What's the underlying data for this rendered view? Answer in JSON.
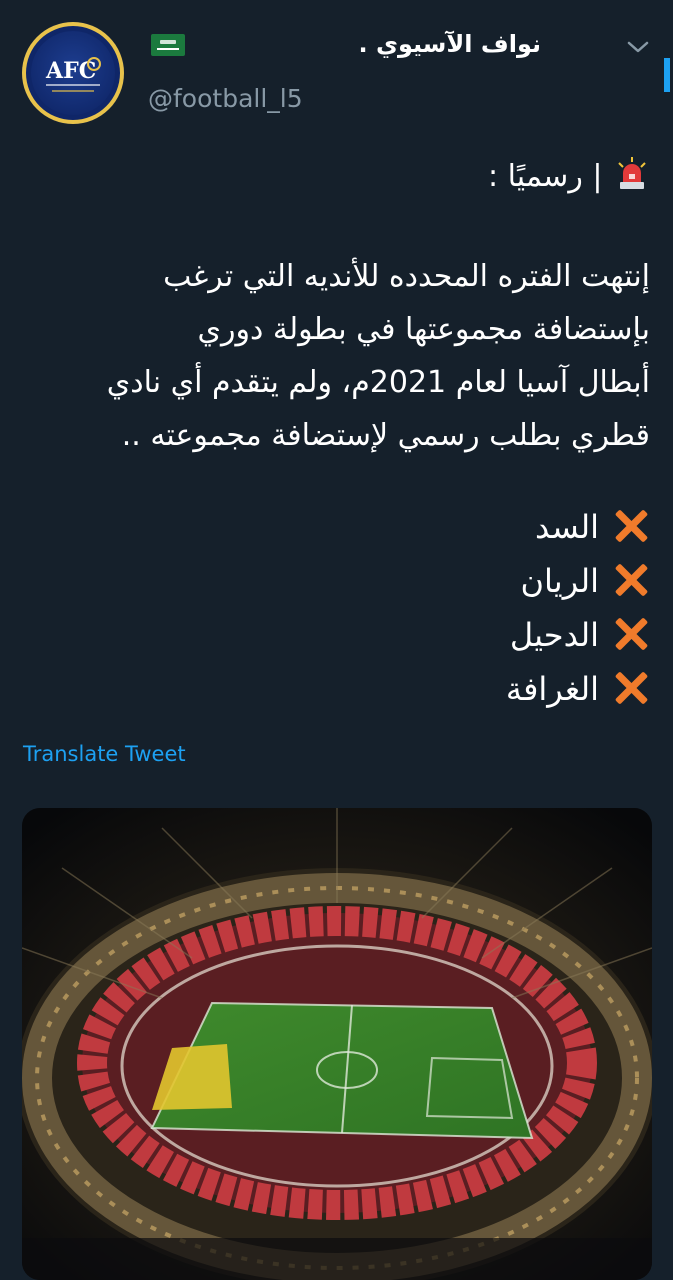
{
  "tweet": {
    "display_name": "نواف الآسيوي .",
    "handle": "@football_l5",
    "header_line": "| رسميًا :",
    "body_lines": [
      "إنتهت الفتره المحدده للأنديه التي ترغب",
      "بإستضافة مجموعتها في بطولة دوري",
      "أبطال آسيا لعام 2021م، ولم يتقدم أي نادي",
      "قطري بطلب رسمي لإستضافة مجموعته .."
    ],
    "clubs": [
      "السد",
      "الريان",
      "الدحيل",
      "الغرافة"
    ],
    "translate_label": "Translate Tweet"
  },
  "icons": {
    "avatar_logo": "afc-logo",
    "flag": "saudi-flag",
    "siren": "rotating-light",
    "cross": "cross-mark",
    "menu": "chevron-down-icon"
  },
  "colors": {
    "background": "#15202b",
    "secondary_text": "#8899a6",
    "link": "#1da1f2",
    "cross": "#f07b2b"
  }
}
